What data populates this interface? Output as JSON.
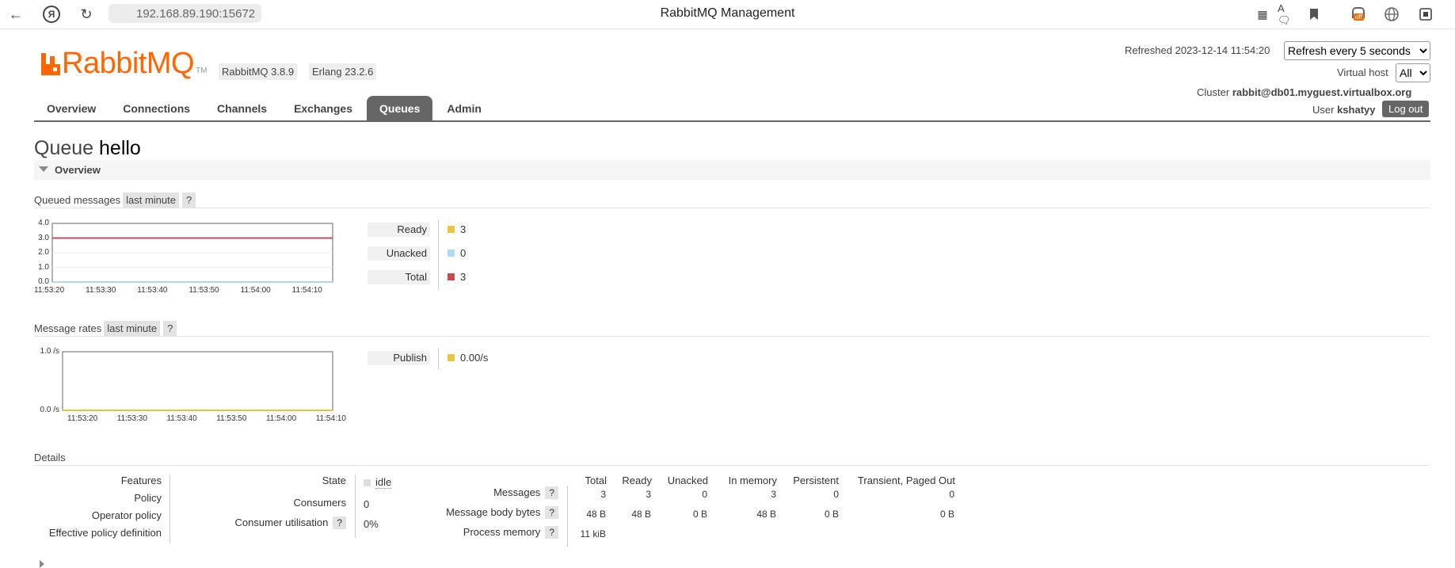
{
  "browser": {
    "url": "192.168.89.190:15672",
    "title": "RabbitMQ Management"
  },
  "header": {
    "logo_text": "RabbitMQ",
    "logo_tm": "TM",
    "rabbitmq_version": "RabbitMQ 3.8.9",
    "erlang_version": "Erlang 23.2.6",
    "refreshed_label": "Refreshed 2023-12-14 11:54:20",
    "refresh_select": "Refresh every 5 seconds",
    "vhost_label": "Virtual host",
    "vhost_select": "All",
    "cluster_label": "Cluster",
    "cluster_value": "rabbit@db01.myguest.virtualbox.org",
    "user_label": "User",
    "user_value": "kshatyy",
    "logout_label": "Log out"
  },
  "tabs": [
    "Overview",
    "Connections",
    "Channels",
    "Exchanges",
    "Queues",
    "Admin"
  ],
  "active_tab": "Queues",
  "queue": {
    "prefix": "Queue",
    "name": "hello"
  },
  "overview_section": "Overview",
  "queued_messages": {
    "title": "Queued messages",
    "range": "last minute",
    "help": "?",
    "chart_data": {
      "type": "line",
      "x": [
        "11:53:20",
        "11:53:30",
        "11:53:40",
        "11:53:50",
        "11:54:00",
        "11:54:10"
      ],
      "y_ticks": [
        "4.0",
        "3.0",
        "2.0",
        "1.0",
        "0.0"
      ],
      "ylim": [
        0,
        4
      ],
      "series": [
        {
          "name": "Ready",
          "values": [
            3,
            3,
            3,
            3,
            3,
            3
          ],
          "color": "#edc240"
        },
        {
          "name": "Unacked",
          "values": [
            0,
            0,
            0,
            0,
            0,
            0
          ],
          "color": "#afd8f8"
        },
        {
          "name": "Total",
          "values": [
            3,
            3,
            3,
            3,
            3,
            3
          ],
          "color": "#cb4b4b"
        }
      ]
    },
    "legend": [
      {
        "label": "Ready",
        "value": "3",
        "color": "#edc240"
      },
      {
        "label": "Unacked",
        "value": "0",
        "color": "#afd8f8"
      },
      {
        "label": "Total",
        "value": "3",
        "color": "#cb4b4b"
      }
    ]
  },
  "message_rates": {
    "title": "Message rates",
    "range": "last minute",
    "help": "?",
    "chart_data": {
      "type": "line",
      "x": [
        "11:53:20",
        "11:53:30",
        "11:53:40",
        "11:53:50",
        "11:54:00",
        "11:54:10"
      ],
      "y_ticks": [
        "1.0 /s",
        "0.0 /s"
      ],
      "ylim": [
        0,
        1
      ],
      "series": [
        {
          "name": "Publish",
          "values": [
            0,
            0,
            0,
            0,
            0,
            0
          ],
          "color": "#edc240"
        }
      ]
    },
    "legend": [
      {
        "label": "Publish",
        "value": "0.00/s",
        "color": "#edc240"
      }
    ]
  },
  "details": {
    "title": "Details",
    "left_labels": [
      "Features",
      "Policy",
      "Operator policy",
      "Effective policy definition"
    ],
    "state_label": "State",
    "state_value": "idle",
    "consumers_label": "Consumers",
    "consumers_value": "0",
    "utilisation_label": "Consumer utilisation",
    "utilisation_value": "0%",
    "help": "?",
    "columns": [
      "Total",
      "Ready",
      "Unacked",
      "In memory",
      "Persistent",
      "Transient, Paged Out"
    ],
    "rows": [
      {
        "label": "Messages",
        "values": [
          "3",
          "3",
          "0",
          "3",
          "0",
          "0"
        ]
      },
      {
        "label": "Message body bytes",
        "values": [
          "48 B",
          "48 B",
          "0 B",
          "48 B",
          "0 B",
          "0 B"
        ]
      },
      {
        "label": "Process memory",
        "values": [
          "11 kiB"
        ]
      }
    ]
  }
}
